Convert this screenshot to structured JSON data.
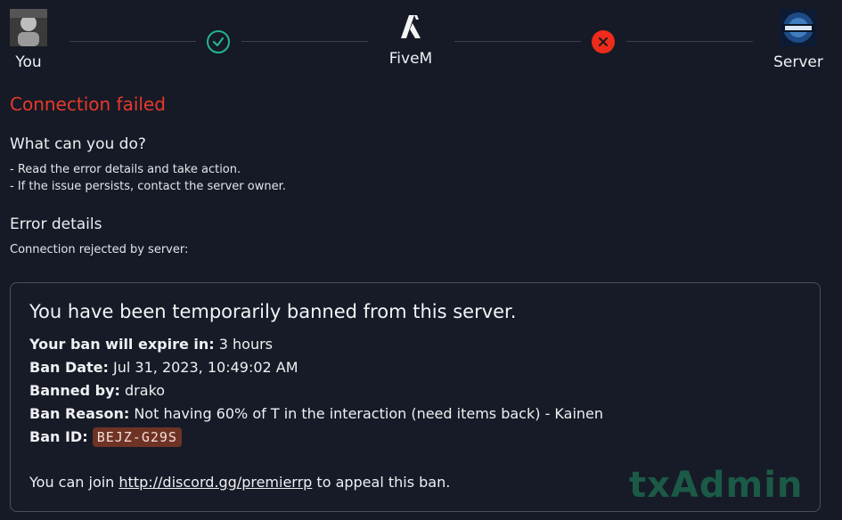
{
  "progress": {
    "you": {
      "label": "You"
    },
    "fivem": {
      "label": "FiveM"
    },
    "server": {
      "label": "Server"
    },
    "step1_status": "success",
    "step2_status": "failed"
  },
  "status_title": "Connection failed",
  "what_to_do": {
    "heading": "What can you do?",
    "items": [
      "- Read the error details and take action.",
      "- If the issue persists, contact the server owner."
    ]
  },
  "error_details": {
    "heading": "Error details",
    "text": "Connection rejected by server:"
  },
  "ban": {
    "title": "You have been temporarily banned from this server.",
    "expire_label": "Your ban will expire in:",
    "expire_value": " 3 hours",
    "date_label": "Ban Date:",
    "date_value": " Jul 31, 2023, 10:49:02 AM",
    "by_label": "Banned by:",
    "by_value": " drako",
    "reason_label": "Ban Reason:",
    "reason_value": " Not having 60% of T in the interaction (need items back) - Kainen",
    "id_label": "Ban ID:",
    "id_value": "BEJZ-G29S",
    "appeal_prefix": "You can join ",
    "appeal_link": "http://discord.gg/premierrp",
    "appeal_suffix": " to appeal this ban.",
    "watermark": "txAdmin"
  },
  "colors": {
    "background": "#161a26",
    "error": "#e8392b",
    "success": "#22b58f",
    "ban_id_bg": "#6f3326"
  }
}
